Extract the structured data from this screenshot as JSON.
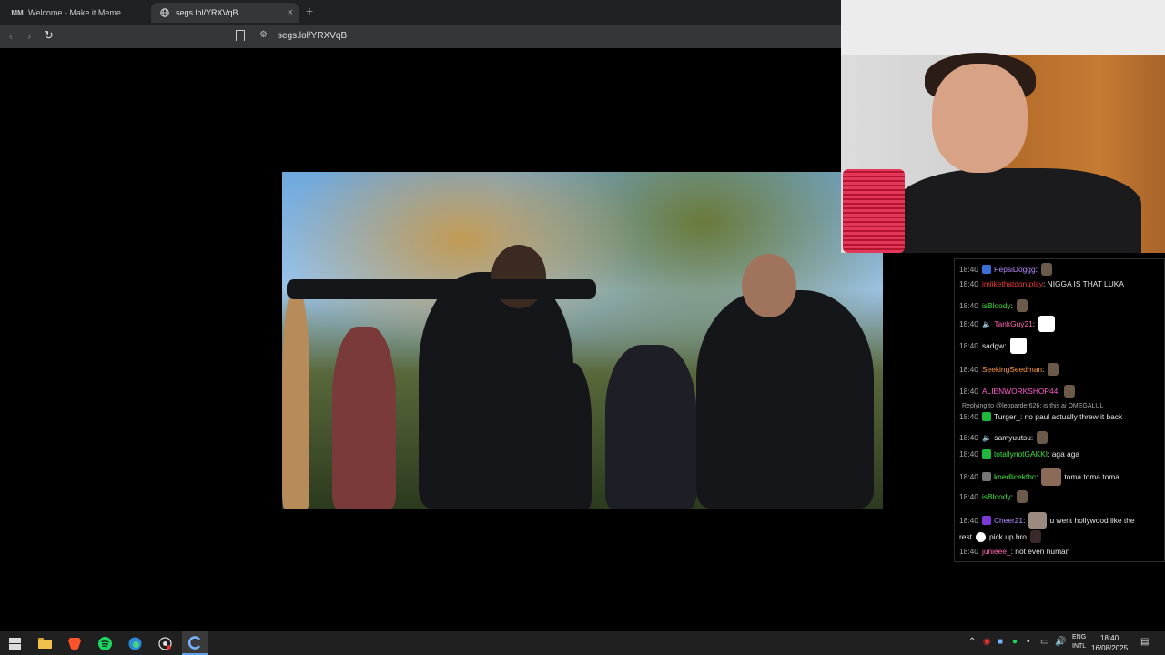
{
  "browser": {
    "tabs": [
      {
        "title": "Welcome - Make it Meme",
        "favicon": "MM",
        "active": false
      },
      {
        "title": "segs.lol/YRXVqB",
        "favicon": "globe-icon",
        "active": true
      }
    ],
    "new_tab_symbol": "+",
    "close_symbol": "×",
    "url": "segs.lol/YRXVqB"
  },
  "chat": {
    "reply_label": "Replying to @leoparder626: is this ai OMEGALUL",
    "messages": [
      {
        "time": "18:40",
        "user": "PepsiDoggg",
        "text": "",
        "color": "#b68bff"
      },
      {
        "time": "18:40",
        "user": "imlikethatdontplay",
        "text": "NIGGA IS THAT LUKA",
        "color": "#e8393a"
      },
      {
        "time": "18:40",
        "user": "isBloody",
        "text": "",
        "color": "#3fe03f"
      },
      {
        "time": "18:40",
        "user": "TankGuy21",
        "text": "",
        "color": "#ff69b4"
      },
      {
        "time": "18:40",
        "user": "sadgw",
        "text": "",
        "color": "#e6e6e6"
      },
      {
        "time": "18:40",
        "user": "SeekingSeedman",
        "text": "",
        "color": "#ff9b3d"
      },
      {
        "time": "18:40",
        "user": "ALIENWORKSHOP44",
        "text": "",
        "color": "#ff5bd1"
      },
      {
        "time": "18:40",
        "user": "Turger_",
        "text": "no paul actually threw it back",
        "color": "#e6e6e6"
      },
      {
        "time": "18:40",
        "user": "samyuutsu",
        "text": "",
        "color": "#e6e6e6"
      },
      {
        "time": "18:40",
        "user": "totallynotGAKKI",
        "text": "aga aga",
        "color": "#3fe03f"
      },
      {
        "time": "18:40",
        "user": "knedlicekthc",
        "text": "toma toma toma",
        "color": "#3fe03f"
      },
      {
        "time": "18:40",
        "user": "isBloody",
        "text": "",
        "color": "#3fe03f"
      },
      {
        "time": "18:40",
        "user": "Cheer21",
        "text": "u went hollywood like the",
        "color": "#b68bff"
      },
      {
        "time": "",
        "user": "",
        "text": "rest",
        "text2": "pick up bro",
        "color": "#e6e6e6"
      },
      {
        "time": "18:40",
        "user": "junieee_",
        "text": "not even human",
        "color": "#ff6bb0"
      }
    ]
  },
  "taskbar": {
    "language": "ENG",
    "layout": "INTL",
    "time": "18:40",
    "date": "16/08/2025"
  }
}
